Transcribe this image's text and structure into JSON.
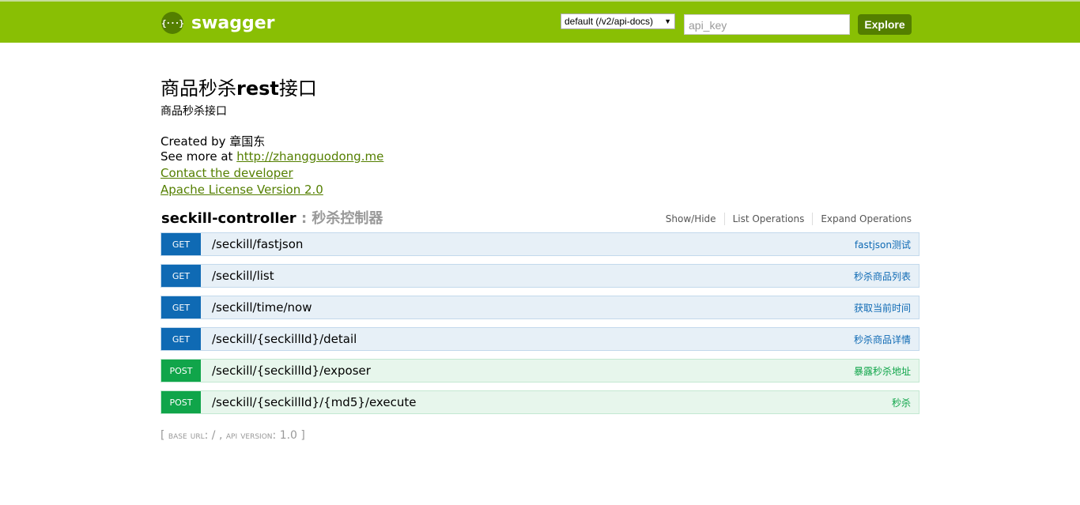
{
  "header": {
    "logo_glyph": "{···}",
    "logo_text": "swagger",
    "spec_select": "default (/v2/api-docs)",
    "api_key_placeholder": "api_key",
    "explore_label": "Explore",
    "colors": {
      "bar": "#89bf04",
      "button": "#547f00"
    }
  },
  "info": {
    "title_prefix": "商品秒杀",
    "title_bold": "rest",
    "title_suffix": "接口",
    "description": "商品秒杀接口",
    "created_by": "Created by 章国东",
    "see_more_prefix": "See more at ",
    "see_more_link": "http://zhangguodong.me",
    "contact": "Contact the developer",
    "license": "Apache License Version 2.0"
  },
  "resource": {
    "name": "seckill-controller",
    "description": ": 秒杀控制器",
    "actions": [
      "Show/Hide",
      "List Operations",
      "Expand Operations"
    ]
  },
  "operations": [
    {
      "method": "GET",
      "path": "/seckill/fastjson",
      "summary": "fastjson测试"
    },
    {
      "method": "GET",
      "path": "/seckill/list",
      "summary": "秒杀商品列表"
    },
    {
      "method": "GET",
      "path": "/seckill/time/now",
      "summary": "获取当前时间"
    },
    {
      "method": "GET",
      "path": "/seckill/{seckillId}/detail",
      "summary": "秒杀商品详情"
    },
    {
      "method": "POST",
      "path": "/seckill/{seckillId}/exposer",
      "summary": "暴露秒杀地址"
    },
    {
      "method": "POST",
      "path": "/seckill/{seckillId}/{md5}/execute",
      "summary": "秒杀"
    }
  ],
  "footer": {
    "open": "[ ",
    "base_url_label": "base url",
    "base_url_value": ": / , ",
    "api_version_label": "api version",
    "api_version_value": ": 1.0 ]"
  }
}
